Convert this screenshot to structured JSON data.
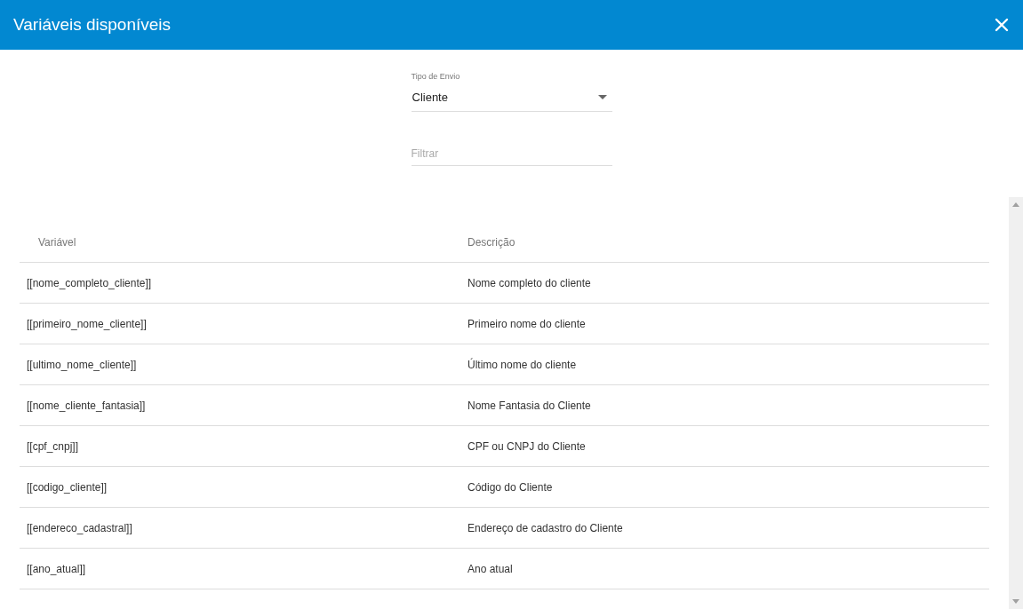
{
  "window": {
    "title": "Variáveis disponíveis"
  },
  "send_type": {
    "label": "Tipo de Envio",
    "value": "Cliente"
  },
  "filter": {
    "placeholder": "Filtrar"
  },
  "table": {
    "columns": [
      "Variável",
      "Descrição"
    ],
    "rows": [
      [
        "[[nome_completo_cliente]]",
        "Nome completo do cliente"
      ],
      [
        "[[primeiro_nome_cliente]]",
        "Primeiro nome do cliente"
      ],
      [
        "[[ultimo_nome_cliente]]",
        "Último nome do cliente"
      ],
      [
        "[[nome_cliente_fantasia]]",
        "Nome Fantasia do Cliente"
      ],
      [
        "[[cpf_cnpj]]",
        "CPF ou CNPJ do Cliente"
      ],
      [
        "[[codigo_cliente]]",
        "Código do Cliente"
      ],
      [
        "[[endereco_cadastral]]",
        "Endereço de cadastro do Cliente"
      ],
      [
        "[[ano_atual]]",
        "Ano atual"
      ]
    ]
  }
}
